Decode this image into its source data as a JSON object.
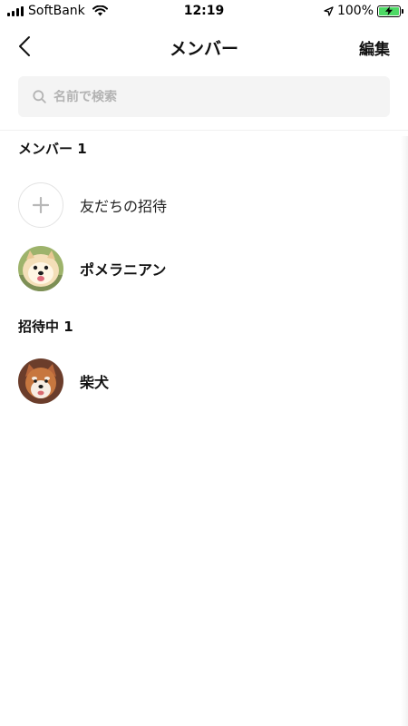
{
  "status_bar": {
    "carrier": "SoftBank",
    "time": "12:19",
    "battery_percent": "100%"
  },
  "header": {
    "title": "メンバー",
    "edit_label": "編集"
  },
  "search": {
    "placeholder": "名前で検索",
    "value": ""
  },
  "members_section": {
    "title": "メンバー 1",
    "invite_label": "友だちの招待",
    "members": [
      {
        "name": "ポメラニアン",
        "avatar": "pomeranian-avatar"
      }
    ]
  },
  "invited_section": {
    "title": "招待中 1",
    "members": [
      {
        "name": "柴犬",
        "avatar": "shiba-avatar"
      }
    ]
  },
  "colors": {
    "search_bg": "#f4f4f4",
    "battery_green": "#4cd964",
    "placeholder": "#b3b3b3"
  }
}
